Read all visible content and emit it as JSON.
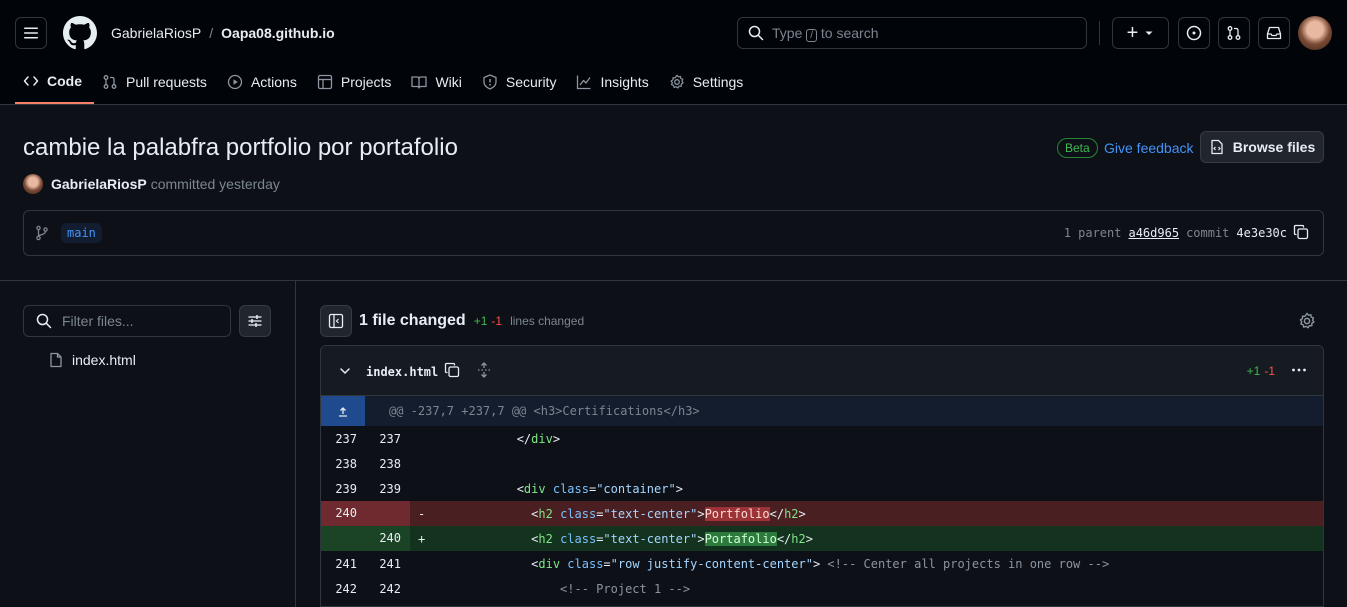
{
  "header": {
    "owner": "GabrielaRiosP",
    "separator": "/",
    "repo": "Oapa08.github.io",
    "search_prefix": "Type",
    "search_key": "/",
    "search_suffix": "to search",
    "plus_label": "+"
  },
  "tabs": [
    {
      "label": "Code",
      "icon": "code-icon",
      "active": true
    },
    {
      "label": "Pull requests",
      "icon": "pull-request-icon"
    },
    {
      "label": "Actions",
      "icon": "play-icon"
    },
    {
      "label": "Projects",
      "icon": "table-icon"
    },
    {
      "label": "Wiki",
      "icon": "book-icon"
    },
    {
      "label": "Security",
      "icon": "shield-icon"
    },
    {
      "label": "Insights",
      "icon": "graph-icon"
    },
    {
      "label": "Settings",
      "icon": "gear-icon"
    }
  ],
  "commit": {
    "title": "cambie la palabfra portfolio por portafolio",
    "author": "GabrielaRiosP",
    "committed": "committed yesterday",
    "beta": "Beta",
    "feedback": "Give feedback",
    "browse": "Browse files",
    "branch": "main",
    "parent_count": "1 parent",
    "parent_hash": "a46d965",
    "commit_word": "commit",
    "commit_hash": "4e3e30c"
  },
  "files": {
    "filter_placeholder": "Filter files...",
    "items": [
      "index.html"
    ]
  },
  "diff": {
    "summary": "1 file changed",
    "additions": "+1",
    "deletions": "-1",
    "lines_changed": "lines changed",
    "file_name": "index.html",
    "hunk": "@@ -237,7 +237,7 @@ <h3>Certifications</h3>",
    "lines": [
      {
        "old": "237",
        "new": "237",
        "type": "ctx",
        "marker": "",
        "code": "            </div>"
      },
      {
        "old": "238",
        "new": "238",
        "type": "ctx",
        "marker": "",
        "code": ""
      },
      {
        "old": "239",
        "new": "239",
        "type": "ctx",
        "marker": "",
        "code": "            <div class=\"container\">"
      },
      {
        "old": "240",
        "new": "",
        "type": "del",
        "marker": "-",
        "code": "              <h2 class=\"text-center\">Portfolio</h2>"
      },
      {
        "old": "",
        "new": "240",
        "type": "add",
        "marker": "+",
        "code": "              <h2 class=\"text-center\">Portafolio</h2>"
      },
      {
        "old": "241",
        "new": "241",
        "type": "ctx",
        "marker": "",
        "code": "              <div class=\"row justify-content-center\"> <!-- Center all projects in one row -->"
      },
      {
        "old": "242",
        "new": "242",
        "type": "ctx",
        "marker": "",
        "code": "                  <!-- Project 1 -->"
      }
    ]
  }
}
